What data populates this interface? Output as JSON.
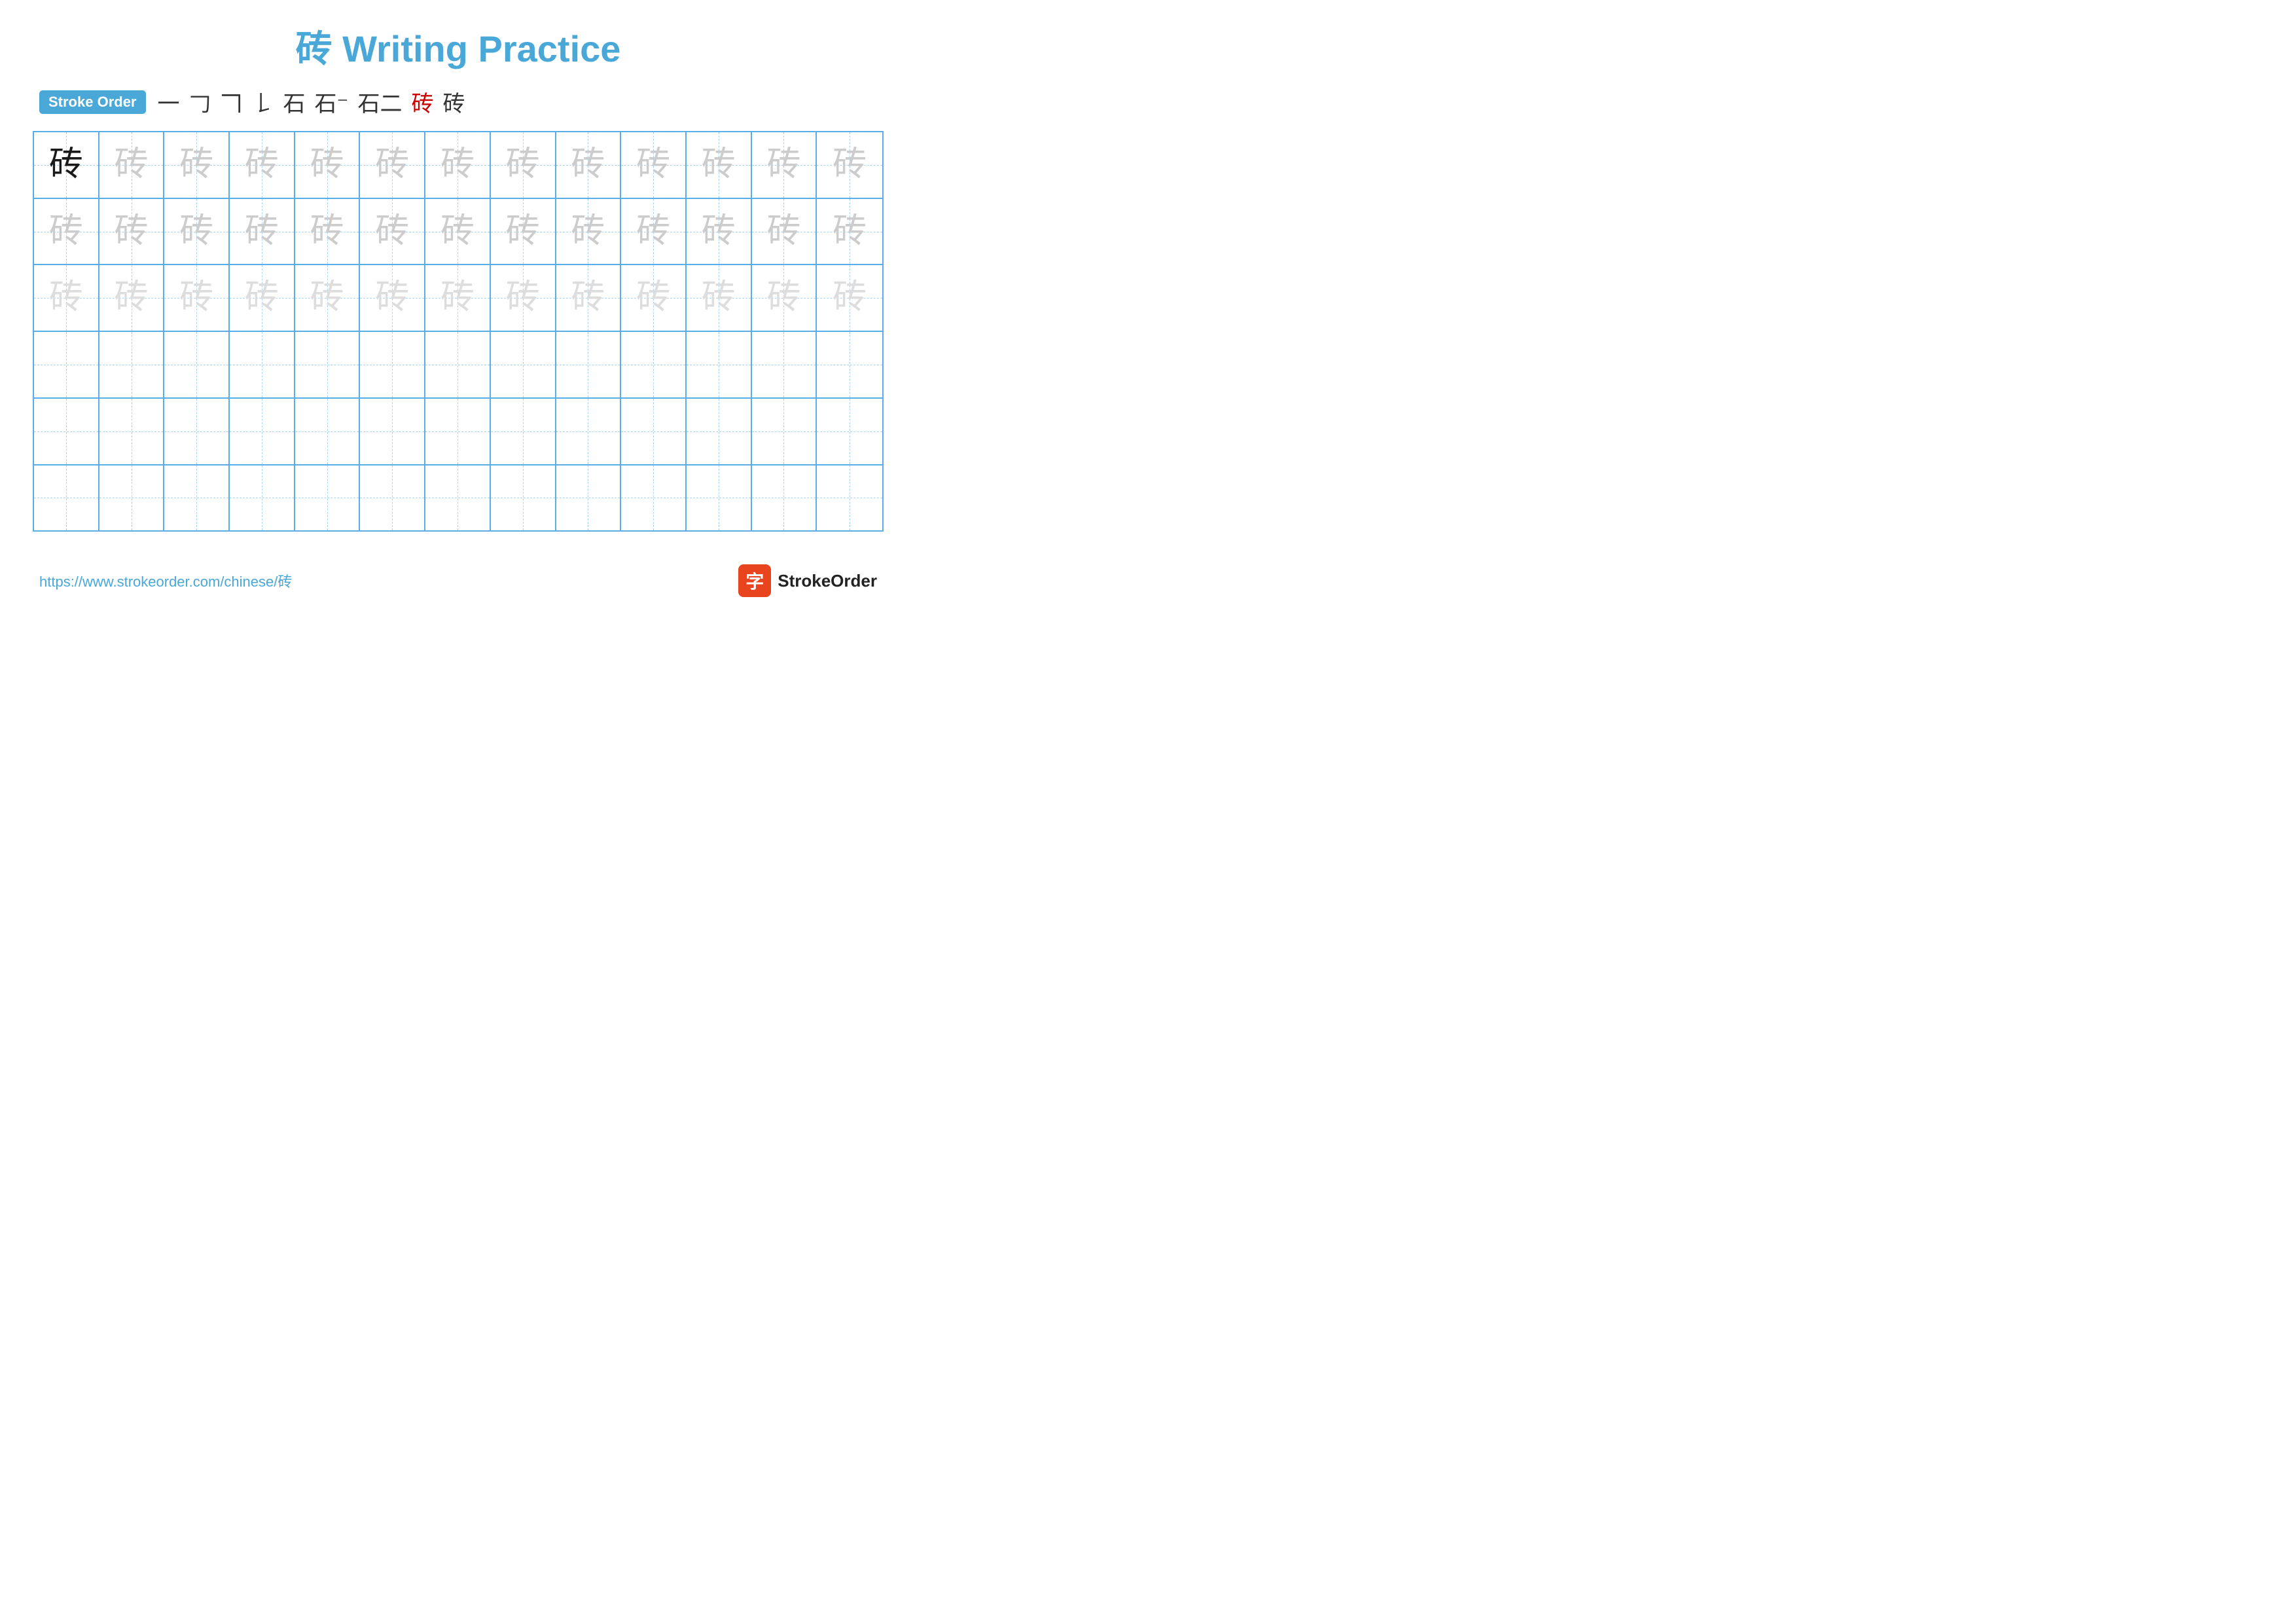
{
  "title": {
    "char": "砖",
    "text": " Writing Practice"
  },
  "stroke_order": {
    "badge_label": "Stroke Order",
    "strokes": [
      "一",
      "𠃌",
      "𠃍",
      "厂",
      "石",
      "石⁻",
      "石二",
      "砖",
      "砖"
    ]
  },
  "grid": {
    "rows": 6,
    "cols": 13,
    "char": "砖",
    "row_types": [
      "dark-guide",
      "light1",
      "light2",
      "empty",
      "empty",
      "empty"
    ]
  },
  "footer": {
    "url": "https://www.strokeorder.com/chinese/砖",
    "logo_icon": "字",
    "logo_text": "StrokeOrder"
  }
}
